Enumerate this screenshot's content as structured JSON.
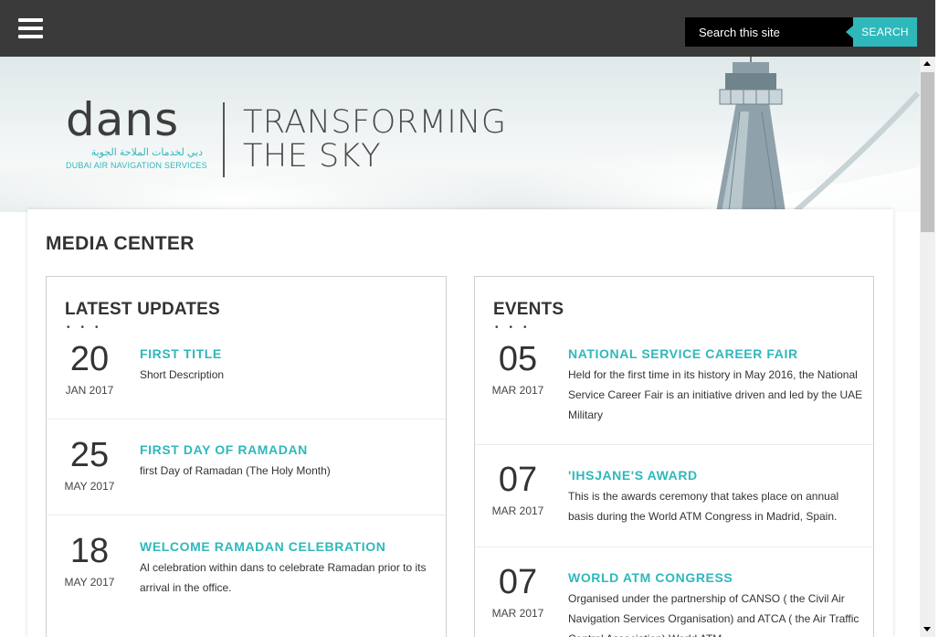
{
  "header": {
    "search_placeholder": "Search this site",
    "search_button": "SEARCH"
  },
  "hero": {
    "logo_text": "dans",
    "logo_arabic": "دبي لخدمات الملاحة الجوية",
    "logo_subtitle": "DUBAI AIR NAVIGATION SERVICES",
    "tagline_line1": "TRANSFORMING",
    "tagline_line2": "THE SKY"
  },
  "page_title": "MEDIA CENTER",
  "latest_updates": {
    "title": "LATEST UPDATES",
    "items": [
      {
        "day": "20",
        "month_year": "JAN 2017",
        "title": "FIRST TITLE",
        "desc": "Short Description"
      },
      {
        "day": "25",
        "month_year": "MAY 2017",
        "title": "FIRST DAY OF RAMADAN",
        "desc": "first Day of Ramadan (The Holy Month)"
      },
      {
        "day": "18",
        "month_year": "MAY 2017",
        "title": "WELCOME RAMADAN CELEBRATION",
        "desc": "Al celebration within dans to celebrate Ramadan prior to its arrival in the office."
      }
    ]
  },
  "events": {
    "title": "EVENTS",
    "items": [
      {
        "day": "05",
        "month_year": "MAR 2017",
        "title": "NATIONAL SERVICE CAREER FAIR",
        "desc": "Held for the first time in its history in May 2016, the National Service Career Fair is an initiative driven and led by the UAE Military"
      },
      {
        "day": "07",
        "month_year": "MAR 2017",
        "title": "'IHSJANE'S AWARD",
        "desc": "This is the awards ceremony that takes place on annual basis during the World ATM Congress in Madrid, Spain."
      },
      {
        "day": "07",
        "month_year": "MAR 2017",
        "title": "WORLD ATM CONGRESS",
        "desc": "Organised under the partnership of CANSO ( the Civil Air Navigation Services Organisation) and ATCA ( the Air Traffic Control Association) World ATM..."
      }
    ]
  },
  "colors": {
    "accent": "#2fb8bb",
    "topbar": "#3a3a3a"
  }
}
